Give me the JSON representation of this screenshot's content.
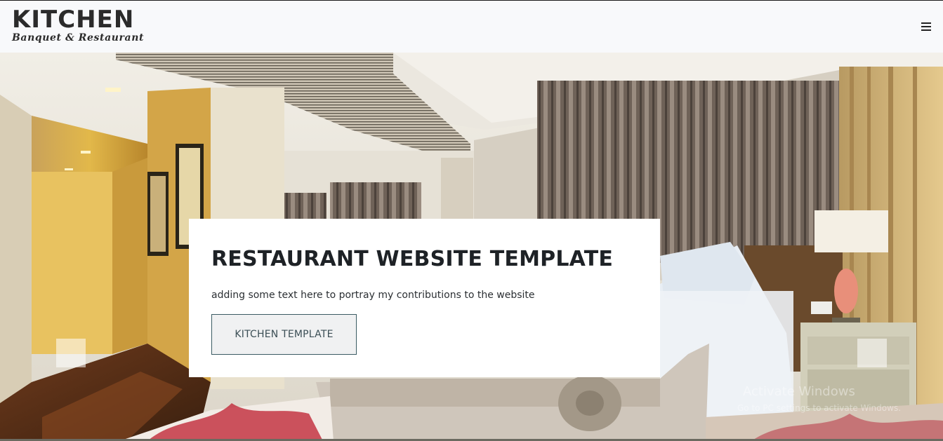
{
  "header": {
    "logo_title": "KITCHEN",
    "logo_subtitle": "Banquet & Restaurant",
    "menu_icon": "hamburger-icon"
  },
  "hero": {
    "title": "RESTAURANT WEBSITE TEMPLATE",
    "text": "adding some text here to portray my contributions to the website",
    "button_label": "KITCHEN TEMPLATE",
    "prev_icon": "carousel-prev-control",
    "next_icon": "carousel-next-control"
  },
  "watermark": {
    "title": "Activate Windows",
    "subtitle": "Go to PC settings to activate Windows."
  },
  "colors": {
    "header_bg": "#f8f9fb",
    "text_dark": "#1e2226",
    "button_border": "#3b5b63"
  }
}
